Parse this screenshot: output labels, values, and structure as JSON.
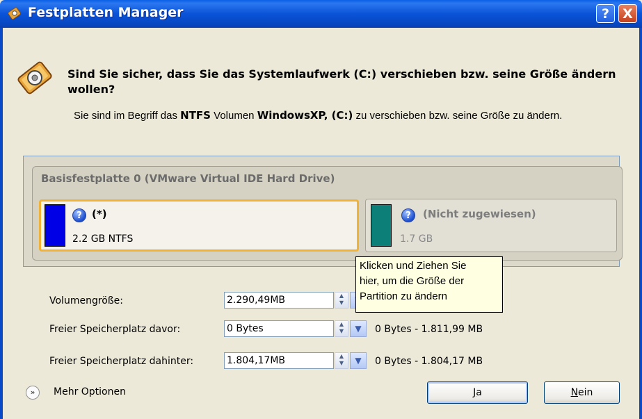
{
  "window": {
    "title": "Festplatten Manager",
    "help_button": "?",
    "close_button": "X"
  },
  "question": "Sind Sie sicher, dass Sie das Systemlaufwerk (C:) verschieben bzw. seine Größe ändern wollen?",
  "info": {
    "prefix": "Sie sind im Begriff das ",
    "fs": "NTFS",
    "middle": " Volumen ",
    "volume": "WindowsXP, (C:)",
    "suffix": " zu verschieben bzw. seine Größe zu ändern."
  },
  "disk": {
    "title": "Basisfestplatte 0 (VMware Virtual IDE Hard Drive)",
    "partitions": [
      {
        "label": "(*)",
        "size": "2.2 GB NTFS",
        "color": "#0000e6",
        "selected": true
      },
      {
        "label": "(Nicht zugewiesen)",
        "size": "1.7 GB",
        "color": "#0c8078",
        "selected": false
      }
    ]
  },
  "tooltip": {
    "line1": "Klicken und Ziehen Sie",
    "line2": "hier, um die Größe der",
    "line3": "Partition zu ändern"
  },
  "fields": {
    "volume_size": {
      "label": "Volumengröße:",
      "value": "2.290,49MB"
    },
    "free_before": {
      "label": "Freier Speicherplatz davor:",
      "value": "0 Bytes",
      "range": "0 Bytes - 1.811,99 MB"
    },
    "free_after": {
      "label": "Freier Speicherplatz dahinter:",
      "value": "1.804,17MB",
      "range": "0 Bytes - 1.804,17 MB"
    }
  },
  "more_options": "Mehr Optionen",
  "buttons": {
    "yes_mnemonic": "J",
    "yes_rest": "a",
    "no_mnemonic": "N",
    "no_rest": "ein"
  }
}
